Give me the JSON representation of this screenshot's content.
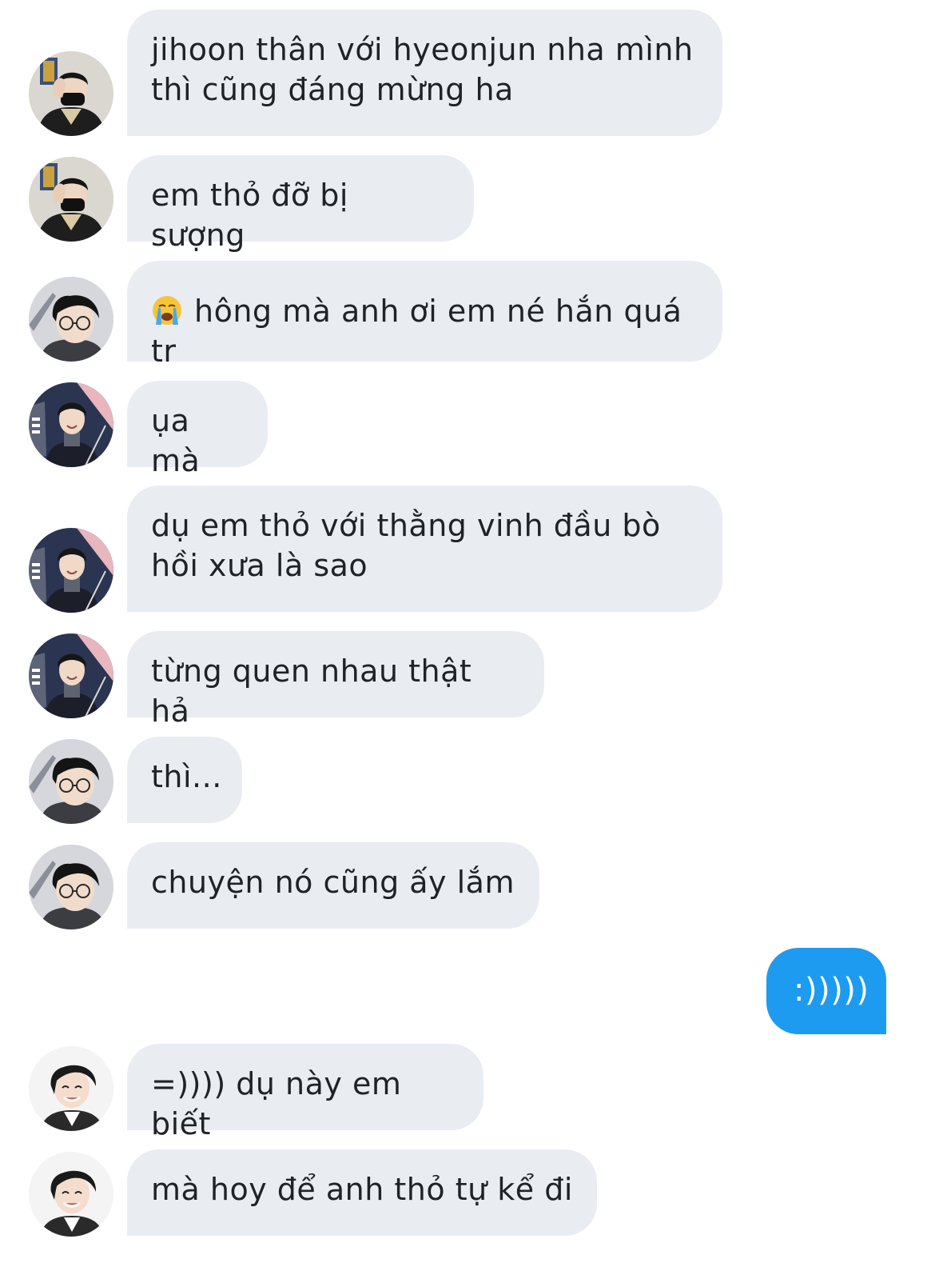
{
  "colors": {
    "received_bubble": "#e9edf1",
    "sent_bubble": "#1d9bf0",
    "text_dark": "#1f2328",
    "text_light": "#ffffff"
  },
  "messages": [
    {
      "direction": "received",
      "avatar": "avatar-user-masked",
      "text": "jihoon thân với hyeonjun nha mình thì cũng đáng mừng ha"
    },
    {
      "direction": "received",
      "avatar": "avatar-user-masked",
      "text": "em thỏ đỡ bị sượng"
    },
    {
      "direction": "received",
      "avatar": "avatar-user-glasses",
      "emoji": "loudly-crying-face-emoji",
      "text": "hông mà anh ơi em né hắn quá tr"
    },
    {
      "direction": "received",
      "avatar": "avatar-user-turtleneck",
      "text": "ụa mà"
    },
    {
      "direction": "received",
      "avatar": "avatar-user-turtleneck",
      "text": "dụ em thỏ với thằng vinh đầu bò hồi xưa là sao"
    },
    {
      "direction": "received",
      "avatar": "avatar-user-turtleneck",
      "text": "từng quen nhau thật hả"
    },
    {
      "direction": "received",
      "avatar": "avatar-user-glasses",
      "text": "thì..."
    },
    {
      "direction": "received",
      "avatar": "avatar-user-glasses",
      "text": "chuyện nó cũng ấy lắm"
    },
    {
      "direction": "sent",
      "text": ":)))))"
    },
    {
      "direction": "received",
      "avatar": "avatar-user-smiling",
      "text": "=)))) dụ này em biết"
    },
    {
      "direction": "received",
      "avatar": "avatar-user-smiling",
      "text": "mà hoy để anh thỏ tự kể đi"
    }
  ]
}
